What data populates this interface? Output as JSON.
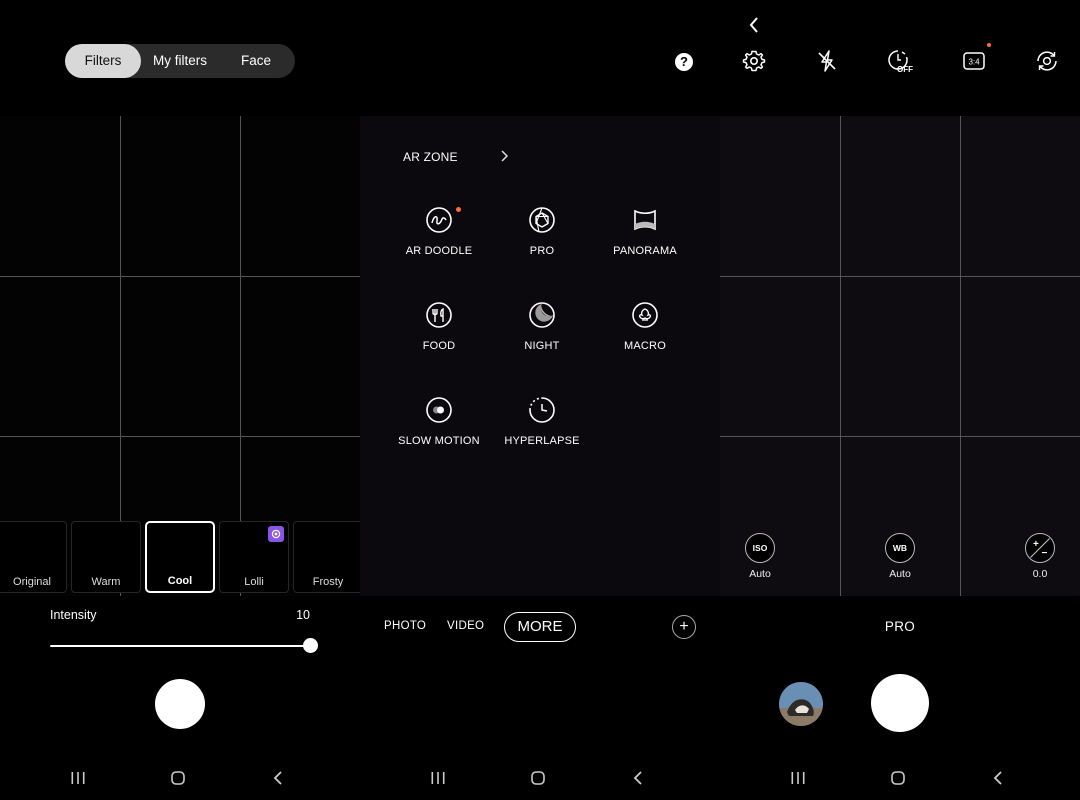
{
  "filters_panel": {
    "segments": [
      "Filters",
      "My filters",
      "Face"
    ],
    "active_segment": "Filters",
    "filters": [
      {
        "label": "Original",
        "selected": false
      },
      {
        "label": "Warm",
        "selected": false
      },
      {
        "label": "Cool",
        "selected": true
      },
      {
        "label": "Lolli",
        "selected": false,
        "badge": "download-icon"
      },
      {
        "label": "Frosty",
        "selected": false
      }
    ],
    "intensity_label": "Intensity",
    "intensity_value": "10",
    "intensity_fraction": 1.0
  },
  "modes_panel": {
    "help_glyph": "?",
    "ar_zone_label": "AR ZONE",
    "modes": [
      {
        "label": "AR DOODLE",
        "icon": "ar-doodle-icon",
        "new": true
      },
      {
        "label": "PRO",
        "icon": "aperture-icon"
      },
      {
        "label": "PANORAMA",
        "icon": "panorama-icon"
      },
      {
        "label": "FOOD",
        "icon": "food-icon"
      },
      {
        "label": "NIGHT",
        "icon": "moon-icon"
      },
      {
        "label": "MACRO",
        "icon": "flower-icon"
      },
      {
        "label": "SLOW MOTION",
        "icon": "slow-motion-icon"
      },
      {
        "label": "HYPERLAPSE",
        "icon": "hyperlapse-icon"
      }
    ],
    "mode_bar": {
      "photo": "PHOTO",
      "video": "VIDEO",
      "more": "MORE",
      "add": "+"
    }
  },
  "pro_panel": {
    "top_icons": [
      "settings-icon",
      "flash-off-icon",
      "timer-off-icon",
      "ratio-icon",
      "switch-camera-icon"
    ],
    "timer_text": "OFF",
    "ratio_text": "3:4",
    "controls": [
      {
        "badge": "ISO",
        "value": "Auto"
      },
      {
        "badge": "WB",
        "value": "Auto"
      },
      {
        "badge": "+/-",
        "value": "0.0"
      }
    ],
    "mode_label": "PRO"
  },
  "colors": {
    "accent_dot": "#ff6a3a",
    "badge_purple": "#8a55e6"
  }
}
